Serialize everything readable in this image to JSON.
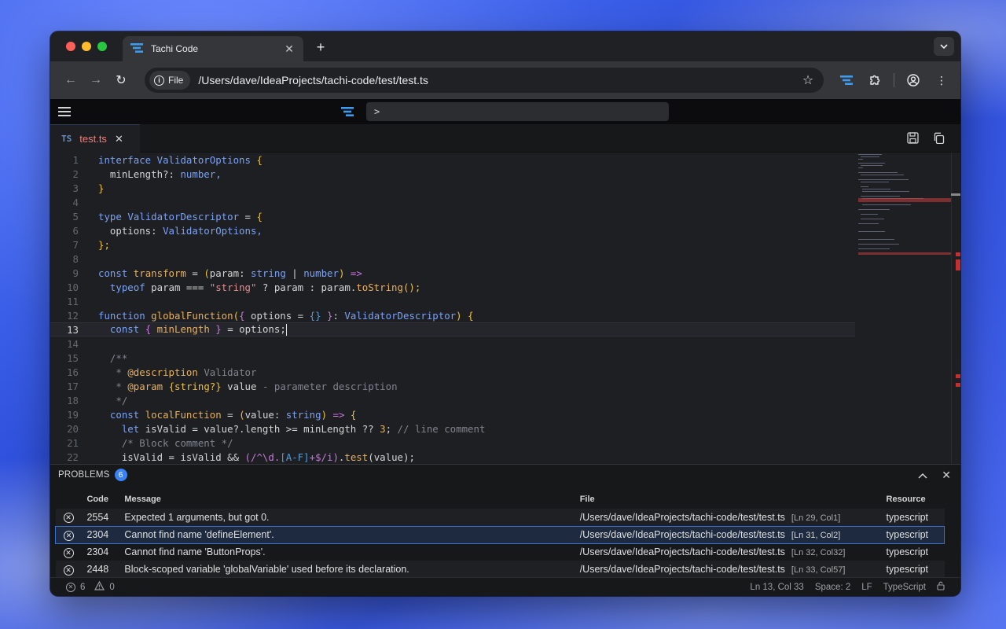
{
  "browser": {
    "tab_title": "Tachi Code",
    "new_tab": "+",
    "chip_label": "File",
    "url": "/Users/dave/IdeaProjects/tachi-code/test/test.ts"
  },
  "app": {
    "command_prompt": ">",
    "editor_tab": {
      "lang_badge": "TS",
      "filename": "test.ts"
    }
  },
  "code_lines": [
    {
      "n": "1"
    },
    {
      "n": "2"
    },
    {
      "n": "3"
    },
    {
      "n": "4"
    },
    {
      "n": "5"
    },
    {
      "n": "6"
    },
    {
      "n": "7"
    },
    {
      "n": "8"
    },
    {
      "n": "9"
    },
    {
      "n": "10"
    },
    {
      "n": "11"
    },
    {
      "n": "12"
    },
    {
      "n": "13"
    },
    {
      "n": "14"
    },
    {
      "n": "15"
    },
    {
      "n": "16"
    },
    {
      "n": "17"
    },
    {
      "n": "18"
    },
    {
      "n": "19"
    },
    {
      "n": "20"
    },
    {
      "n": "21"
    },
    {
      "n": "22"
    }
  ],
  "code": {
    "l1": [
      "interface",
      "ValidatorOptions",
      "{"
    ],
    "l2": [
      "minLength?:",
      "number,"
    ],
    "l3": [
      "}"
    ],
    "l5": [
      "type",
      "ValidatorDescriptor",
      "=",
      "{"
    ],
    "l6": [
      "options:",
      "ValidatorOptions,"
    ],
    "l7": [
      "};"
    ],
    "l9": [
      "const",
      "transform",
      "=",
      "(",
      "param:",
      "string",
      "|",
      "number",
      ")",
      "=>"
    ],
    "l10": [
      "typeof",
      "param ===",
      "\"string\"",
      "? param : param.",
      "toString",
      "();"
    ],
    "l12": [
      "function",
      "globalFunction",
      "(",
      "{",
      "options = ",
      "{}",
      "}",
      ":",
      "ValidatorDescriptor",
      ")",
      "{"
    ],
    "l13": [
      "const",
      "{",
      "minLength",
      "}",
      "= options;"
    ],
    "l15": [
      "/**"
    ],
    "l16": [
      "*",
      "@description",
      "Validator"
    ],
    "l17": [
      "*",
      "@param",
      "{string?}",
      "value",
      "- parameter description"
    ],
    "l18": [
      "*/"
    ],
    "l19": [
      "const",
      "localFunction",
      "=",
      "(",
      "value:",
      "string",
      ")",
      "=>",
      "{"
    ],
    "l20": [
      "let",
      "isValid = value?.length >= minLength ??",
      "3",
      ";",
      "// line comment"
    ],
    "l21": [
      "/* Block comment */"
    ],
    "l22": [
      "isValid = isValid &&",
      "(",
      "/^\\d.",
      "[A-F]",
      "+$/i",
      ")",
      ".",
      "test",
      "(value);"
    ]
  },
  "problems": {
    "title": "PROBLEMS",
    "count": "6",
    "headers": {
      "code": "Code",
      "message": "Message",
      "file": "File",
      "resource": "Resource"
    },
    "rows": [
      {
        "code": "2554",
        "message": "Expected 1 arguments, but got 0.",
        "file": "/Users/dave/IdeaProjects/tachi-code/test/test.ts",
        "loc": "[Ln 29, Col1]",
        "resource": "typescript"
      },
      {
        "code": "2304",
        "message": "Cannot find name 'defineElement'.",
        "file": "/Users/dave/IdeaProjects/tachi-code/test/test.ts",
        "loc": "[Ln 31, Col2]",
        "resource": "typescript"
      },
      {
        "code": "2304",
        "message": "Cannot find name 'ButtonProps'.",
        "file": "/Users/dave/IdeaProjects/tachi-code/test/test.ts",
        "loc": "[Ln 32, Col32]",
        "resource": "typescript"
      },
      {
        "code": "2448",
        "message": "Block-scoped variable 'globalVariable' used before its declaration.",
        "file": "/Users/dave/IdeaProjects/tachi-code/test/test.ts",
        "loc": "[Ln 33, Col57]",
        "resource": "typescript"
      }
    ]
  },
  "status": {
    "errors": "6",
    "warnings": "0",
    "position": "Ln 13, Col 33",
    "spaces": "Space: 2",
    "eol": "LF",
    "language": "TypeScript"
  },
  "colors": {
    "accent": "#3b82f6",
    "error": "#c43030",
    "filename": "#f07f7a"
  },
  "icons": [
    "back-arrow-icon",
    "forward-arrow-icon",
    "reload-icon",
    "info-icon",
    "star-icon",
    "extension-icon",
    "profile-icon",
    "more-icon",
    "save-icon",
    "copy-icon",
    "chevron-up-icon",
    "close-icon",
    "error-icon",
    "warning-icon",
    "lock-icon"
  ]
}
